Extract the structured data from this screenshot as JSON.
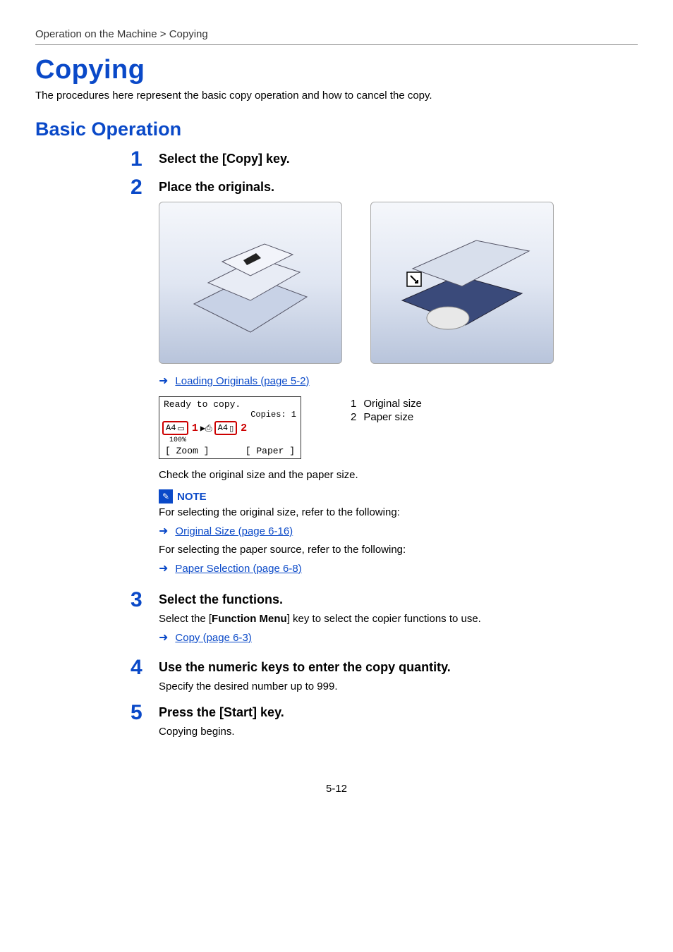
{
  "breadcrumb": "Operation on the Machine > Copying",
  "h1": "Copying",
  "intro": "The procedures here represent the basic copy operation and how to cancel the copy.",
  "h2": "Basic Operation",
  "steps": {
    "s1": {
      "num": "1",
      "title": "Select the [Copy] key."
    },
    "s2": {
      "num": "2",
      "title": "Place the originals.",
      "link1": "Loading Originals (page 5-2)",
      "lcd": {
        "ready": "Ready to copy.",
        "copies": "Copies:  1",
        "size1": "A4",
        "callout1": "1",
        "size2": "A4",
        "callout2": "2",
        "percent": "100%",
        "tab1": "Zoom",
        "tab2": "Paper"
      },
      "legend1_num": "1",
      "legend1_text": "Original size",
      "legend2_num": "2",
      "legend2_text": "Paper size",
      "check_text": "Check the original size and the paper size.",
      "note_label": "NOTE",
      "note_text1": "For selecting the original size, refer to the following:",
      "note_link1": "Original Size (page 6-16)",
      "note_text2": "For selecting the paper source, refer to the following:",
      "note_link2": "Paper Selection (page 6-8)"
    },
    "s3": {
      "num": "3",
      "title": "Select the functions.",
      "text_pre": "Select the [",
      "text_bold": "Function Menu",
      "text_post": "] key to select the copier functions to use.",
      "link": "Copy (page 6-3)"
    },
    "s4": {
      "num": "4",
      "title": "Use the numeric keys to enter the copy quantity.",
      "text": "Specify the desired number up to 999."
    },
    "s5": {
      "num": "5",
      "title": "Press the [Start] key.",
      "text": "Copying begins."
    }
  },
  "page_num": "5-12"
}
